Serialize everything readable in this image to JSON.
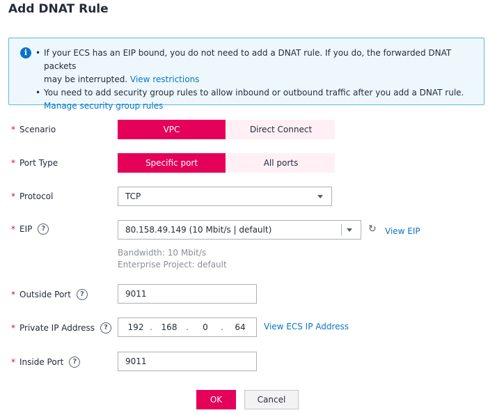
{
  "title": "Add DNAT Rule",
  "notice": {
    "line1": "If your ECS has an EIP bound, you do not need to add a DNAT rule. If you do, the forwarded DNAT packets",
    "line1b": "may be interrupted. ",
    "link1": "View restrictions",
    "line2": "You need to add security group rules to allow inbound or outbound traffic after you add a DNAT rule.",
    "link2": "Manage security group rules"
  },
  "scenario": {
    "label": "Scenario",
    "options": [
      "VPC",
      "Direct Connect"
    ],
    "selected": "VPC"
  },
  "port_type": {
    "label": "Port Type",
    "options": [
      "Specific port",
      "All ports"
    ],
    "selected": "Specific port"
  },
  "protocol": {
    "label": "Protocol",
    "value": "TCP"
  },
  "eip": {
    "label": "EIP",
    "value": "80.158.49.149 (10 Mbit/s | default)",
    "view_link": "View EIP",
    "bandwidth": "Bandwidth: 10 Mbit/s",
    "enterprise_project": "Enterprise Project: default"
  },
  "outside_port": {
    "label": "Outside Port",
    "value": "9011"
  },
  "private_ip": {
    "label": "Private IP Address",
    "octets": [
      "192",
      "168",
      "0",
      "64"
    ],
    "view_link": "View ECS IP Address"
  },
  "inside_port": {
    "label": "Inside Port",
    "value": "9011"
  },
  "buttons": {
    "ok": "OK",
    "cancel": "Cancel"
  },
  "colors": {
    "accent": "#e5005a",
    "link": "#0a73c9",
    "required": "#e5004d"
  }
}
